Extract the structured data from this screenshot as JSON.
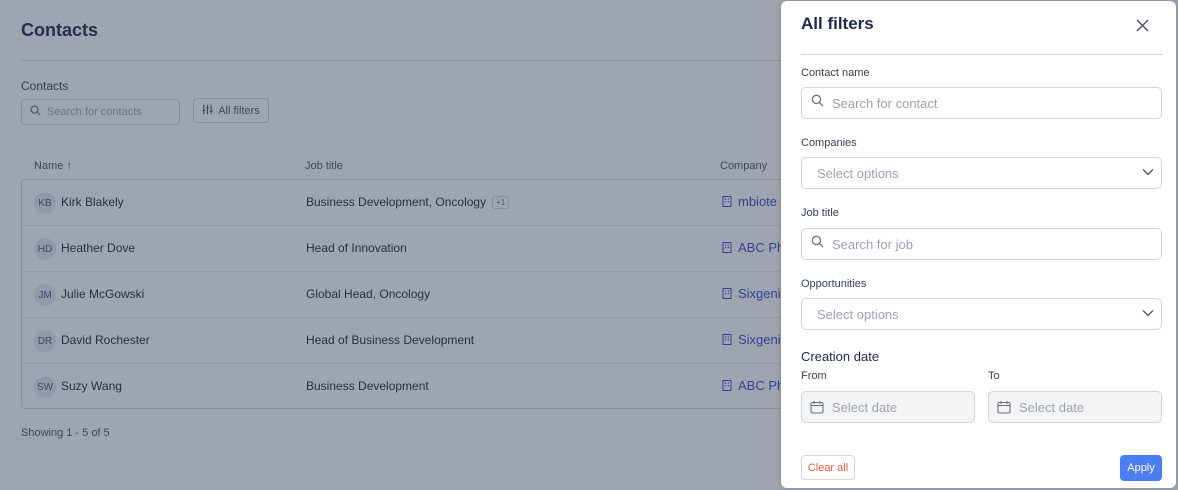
{
  "page": {
    "title": "Contacts",
    "section_label": "Contacts",
    "search_placeholder": "Search for contacts",
    "filters_button_label": "All filters",
    "showing": "Showing 1 - 5 of 5"
  },
  "table": {
    "headers": {
      "name": "Name ↑",
      "job": "Job title",
      "company": "Company"
    },
    "rows": [
      {
        "initials": "KB",
        "name": "Kirk Blakely",
        "job": "Business Development, Oncology",
        "badge": "+1",
        "company": "mbiote"
      },
      {
        "initials": "HD",
        "name": "Heather Dove",
        "job": "Head of Innovation",
        "badge": "",
        "company": "ABC Ph"
      },
      {
        "initials": "JM",
        "name": "Julie McGowski",
        "job": "Global Head, Oncology",
        "badge": "",
        "company": "Sixgeni"
      },
      {
        "initials": "DR",
        "name": "David Rochester",
        "job": "Head of Business Development",
        "badge": "",
        "company": "Sixgeni"
      },
      {
        "initials": "SW",
        "name": "Suzy Wang",
        "job": "Business Development",
        "badge": "",
        "company": "ABC Ph"
      }
    ]
  },
  "drawer": {
    "title": "All filters",
    "contact_name_label": "Contact name",
    "contact_name_placeholder": "Search for contact",
    "companies_label": "Companies",
    "companies_placeholder": "Select options",
    "job_title_label": "Job title",
    "job_title_placeholder": "Search for job",
    "opportunities_label": "Opportunities",
    "opportunities_placeholder": "Select options",
    "creation_date_label": "Creation date",
    "from_label": "From",
    "to_label": "To",
    "from_placeholder": "Select date",
    "to_placeholder": "Select date",
    "clear_label": "Clear all",
    "apply_label": "Apply"
  },
  "colors": {
    "overlay": "#283750",
    "accent": "#4c7ef3",
    "title": "#1e2a4a",
    "danger": "#e05a44",
    "link": "#3b4bcf"
  },
  "icons": [
    "search-icon",
    "filter-sliders-icon",
    "building-icon",
    "close-icon",
    "chevron-down-icon",
    "calendar-icon"
  ]
}
